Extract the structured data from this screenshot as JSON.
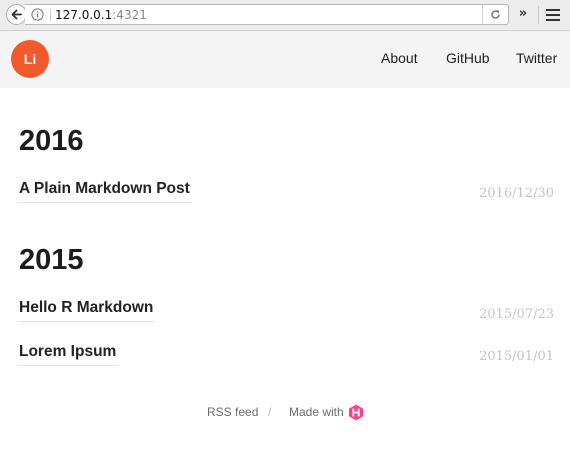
{
  "browser": {
    "url_host": "127.0.0.1",
    "url_port": ":4321",
    "overflow_label": "»"
  },
  "header": {
    "logo_text": "Li",
    "nav": [
      {
        "label": "About"
      },
      {
        "label": "GitHub"
      },
      {
        "label": "Twitter"
      }
    ]
  },
  "archive": [
    {
      "year": "2016",
      "posts": [
        {
          "title": "A Plain Markdown Post",
          "date": "2016/12/30"
        }
      ]
    },
    {
      "year": "2015",
      "posts": [
        {
          "title": "Hello R Markdown",
          "date": "2015/07/23"
        },
        {
          "title": "Lorem Ipsum",
          "date": "2015/01/01"
        }
      ]
    }
  ],
  "footer": {
    "rss_label": "RSS feed",
    "separator": "/",
    "made_with_label": "Made with",
    "made_with_icon": "hugo-icon"
  },
  "colors": {
    "logo_bg": "#f15a2b",
    "header_bg": "#f4f4f4",
    "hugo_brand": "#ff4088",
    "date_text": "#c4c4c4"
  }
}
